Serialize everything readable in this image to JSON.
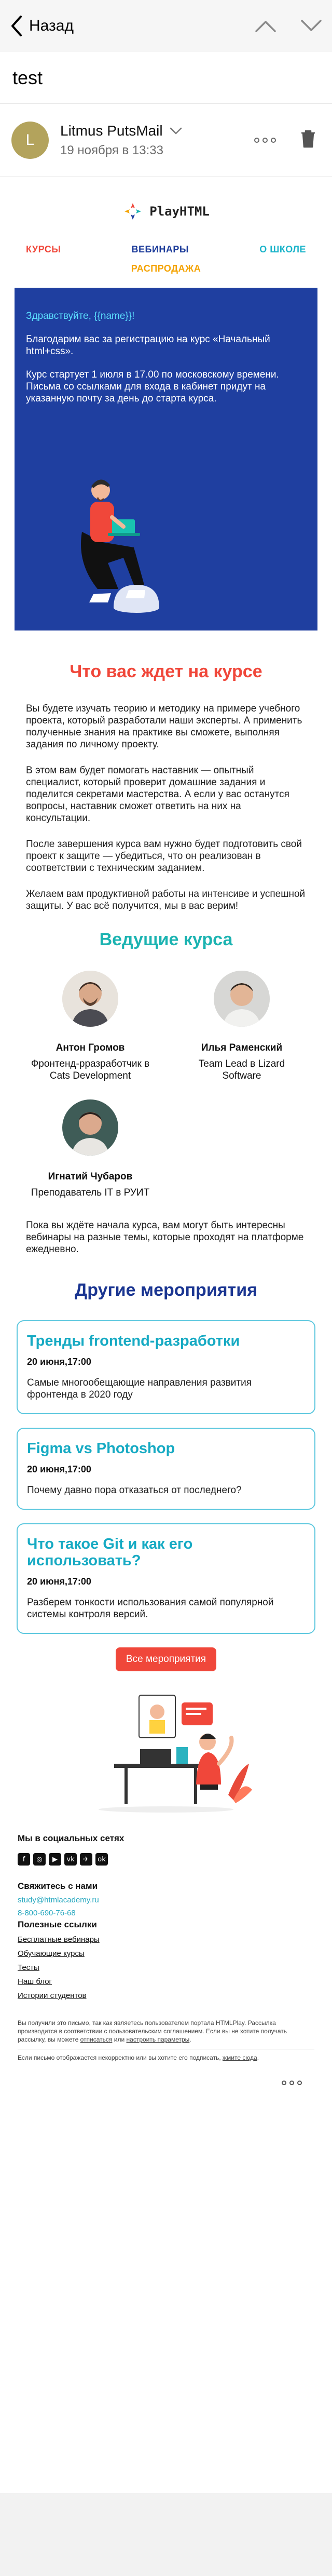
{
  "toolbar": {
    "back_label": "Назад"
  },
  "subject": "test",
  "sender": {
    "initial": "L",
    "name": "Litmus PutsMail",
    "date": "19 ноября в 13:33"
  },
  "email": {
    "logo_text": "PlayHTML",
    "menu": [
      {
        "label": "КУРСЫ",
        "color": "#f0473a"
      },
      {
        "label": "ВЕБИНАРЫ",
        "color": "#1d3c9a"
      },
      {
        "label": "О ШКОЛЕ",
        "color": "#18b3c9"
      },
      {
        "label": "РАСПРОДАЖА",
        "color": "#f4a300"
      }
    ],
    "hero": {
      "greeting": "Здравствуйте, {{name}}!",
      "p1": "Благодарим вас за регистрацию на курс «Начальный html+css».",
      "p2": "Курс стартует 1 июля в 17.00 по московскому времени. Письма со ссылками для входа в кабинет придут на указанную почту за день до старта курса."
    },
    "expect": {
      "title": "Что вас ждет на курсе",
      "paragraphs": [
        "Вы будете изучать теорию и методику на примере учебного проекта, который разработали наши эксперты. А применить полученные знания на практике вы сможете, выполняя задания по личному проекту.",
        "В этом вам будет помогать наставник — опытный специалист, который проверит домашние задания и поделится секретами мастерства. А если у вас останутся вопросы, наставник сможет ответить на них на консультации.",
        "После завершения курса вам нужно будет подготовить свой проект к защите — убедиться, что он реализован в соответствии с техническим заданием.",
        "Желаем вам продуктивной работы на интенсиве и успешной защиты. У вас всё получится, мы в вас верим!"
      ]
    },
    "teachers": {
      "title": "Ведущие курса",
      "items": [
        {
          "name": "Антон Громов",
          "role": "Фронтенд-рразработчик в Cats Development"
        },
        {
          "name": "Илья Раменский",
          "role": "Team Lead в Lizard Software"
        },
        {
          "name": "Игнатий Чубаров",
          "role": "Преподаватель IT в РУИТ"
        }
      ],
      "after": "Пока вы ждёте начала курса, вам могут быть интересны вебинары на разные темы, которые проходят на платформе ежедневно."
    },
    "events": {
      "title": "Другие мероприятия",
      "items": [
        {
          "title": "Тренды frontend-разработки",
          "date": "20 июня,17:00",
          "desc": "Самые многообещающие направления развития фронтенда в 2020 году"
        },
        {
          "title": "Figma vs Photoshop",
          "date": "20 июня,17:00",
          "desc": "Почему давно пора отказаться от последнего?"
        },
        {
          "title": "Что такое Git и как его использовать?",
          "date": "20 июня,17:00",
          "desc": "Разберем тонкости использования самой популярной системы контроля версий."
        }
      ],
      "button": "Все мероприятия"
    },
    "footer": {
      "social_title": "Мы в социальных сетях",
      "socials": [
        "f",
        "◎",
        "▶",
        "vk",
        "✈",
        "ok"
      ],
      "contact_title": "Свяжитесь с нами",
      "email": "study@htmlacademy.ru",
      "phone": "8-800-690-76-68",
      "links_title": "Полезные ссылки",
      "links": [
        "Бесплатные вебинары",
        "Обучающие курсы",
        "Тесты",
        "Наш блог",
        "Истории студентов"
      ],
      "legal1": "Вы получили это письмо, так как являетесь пользователем портала HTMLPlay. Рассылка производится в соответствии с пользовательским соглашением. Если вы не хотите получать рассылку, вы можете",
      "legal1_link1": "отписаться",
      "legal1_mid": "или",
      "legal1_link2": "настроить параметры",
      "legal2": "Если письмо отображается некорректно или вы хотите его подписать,",
      "legal2_link": "жмите сюда"
    }
  }
}
